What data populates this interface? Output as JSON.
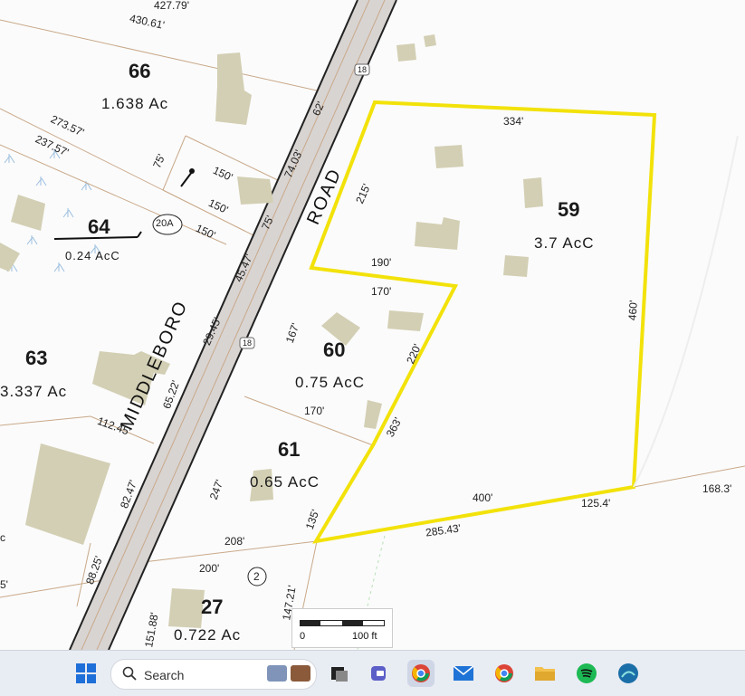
{
  "map": {
    "parcels": [
      {
        "id": "66",
        "area": "1.638  Ac"
      },
      {
        "id": "64",
        "area": "0.24  AcC"
      },
      {
        "id": "63",
        "area": "3.337  Ac"
      },
      {
        "id": "60",
        "area": "0.75  AcC"
      },
      {
        "id": "59",
        "area": "3.7  AcC"
      },
      {
        "id": "61",
        "area": "0.65  AcC"
      },
      {
        "id": "27",
        "area": "0.722  Ac"
      }
    ],
    "road_name_lower": "MIDDLEBORO",
    "road_name_upper": "ROAD",
    "route_badge_1": "18",
    "route_badge_2": "18",
    "circle_20a": "20A",
    "circle_2": "2",
    "dimensions": {
      "d427": "427.79'",
      "d430": "430.61'",
      "d62": "62'",
      "d273": "273.57'",
      "d237": "237.57'",
      "d75a": "75'",
      "d150a": "150'",
      "d74": "74.03'",
      "d150b": "150'",
      "d75b": "75'",
      "d150c": "150'",
      "d45": "45.47'",
      "d29": "29.45'",
      "d334": "334'",
      "d215": "215'",
      "d190": "190'",
      "d170a": "170'",
      "d167": "167'",
      "d220": "220'",
      "d460": "460'",
      "d65": "65.22'",
      "d112": "112.45'",
      "d170b": "170'",
      "d363": "363'",
      "d82": "82.47'",
      "d247": "247'",
      "d400": "400'",
      "d1254": "125.4'",
      "d168": "168.3'",
      "d135": "135'",
      "d285": "285.43'",
      "d208": "208'",
      "d88": "88.25'",
      "d200": "200'",
      "d147": "147.21'",
      "d151": "151.88'",
      "d5": "5'",
      "dc": "c"
    },
    "scale": {
      "start": "0",
      "end": "100 ft"
    }
  },
  "taskbar": {
    "search_label": "Search",
    "apps": [
      "windows-start",
      "search",
      "widgets",
      "task-view",
      "teams",
      "chrome-profile",
      "mail",
      "chrome",
      "file-explorer",
      "spotify",
      "maps"
    ]
  },
  "colors": {
    "boundary": "#f2e20a",
    "building": "#d3cfb4",
    "road": "#d8d4d2"
  }
}
